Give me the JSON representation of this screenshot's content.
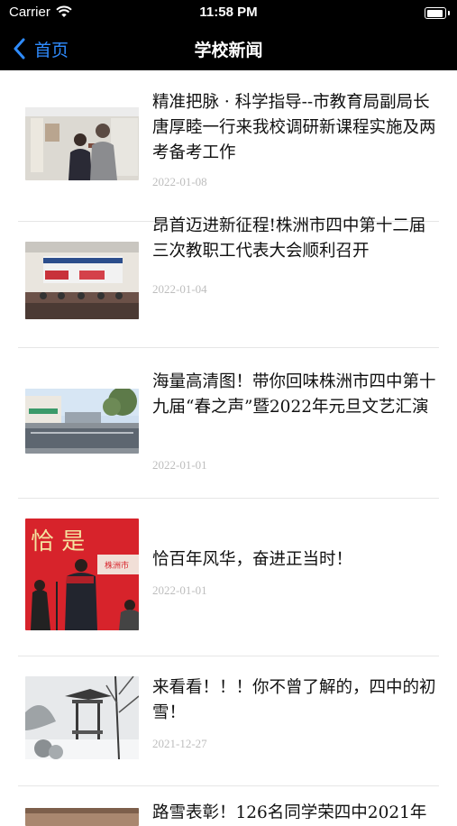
{
  "status_bar": {
    "carrier": "Carrier",
    "time": "11:58 PM",
    "battery_level": 1.0
  },
  "nav": {
    "back_label": "首页",
    "title": "学校新闻"
  },
  "news": [
    {
      "title": "精准把脉 · 科学指导--市教育局副局长唐厚睦一行来我校调研新课程实施及两考备考工作",
      "date": "2022-01-08"
    },
    {
      "title": "昂首迈进新征程!株洲市四中第十二届三次教职工代表大会顺利召开",
      "date": "2022-01-04"
    },
    {
      "title": "海量高清图！带你回味株洲市四中第十九届“春之声”暨2022年元旦文艺汇演",
      "date": "2022-01-01"
    },
    {
      "title": "恰百年风华，奋进正当时！",
      "date": "2022-01-01",
      "image_text": "恰 是",
      "image_banner": "株洲市"
    },
    {
      "title": "来看看！！！你不曾了解的，四中的初雪！",
      "date": "2021-12-27"
    },
    {
      "title": "路雪表彰！126名同学荣四中2021年",
      "date": ""
    }
  ],
  "colors": {
    "nav_bg": "#000000",
    "back_tint": "#2f8cff",
    "date": "#bdbdbd",
    "separator": "#e6e6e6"
  }
}
